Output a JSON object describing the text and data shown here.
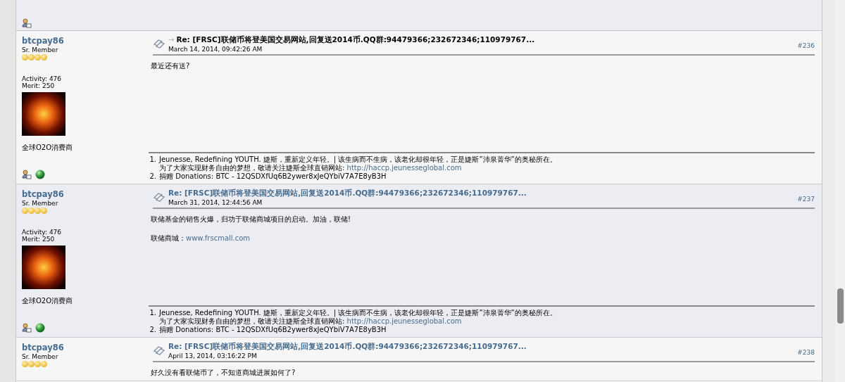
{
  "previous_post": {
    "profile_icon": true
  },
  "posts": [
    {
      "author": "btcpay86",
      "rank": "Sr. Member",
      "stars": 4,
      "activity": "Activity: 476",
      "merit": "Merit: 250",
      "personal_text": "全球O2O消费商",
      "current": true,
      "marker": "→",
      "title": "Re: [FRSC]联储币将登美国交易网站,回复送2014币.QQ群:94479366;232672346;110979767...",
      "date": "March 14, 2014, 09:42:26 AM",
      "number": "#236",
      "body": [
        {
          "text": "最近还有送?"
        }
      ],
      "signature": [
        {
          "number": "1.",
          "text": "Jeunesse, Redefining YOUTH. 婕斯，重新定义年轻。| 该生病而不生病，该老化却很年轻，正是婕斯”沛泉菁华”的奥秘所在。"
        },
        {
          "text": "为了大家实现财务自由的梦想，敬请关注婕斯全球直销网站: ",
          "link": "http://haccp.jeunesseglobal.com"
        },
        {
          "number": "2.",
          "text": "捐赠 Donations:  BTC - 12QSDXfUq6B2ywer8xJeQYbiV7A7E8yB3H"
        }
      ]
    },
    {
      "author": "btcpay86",
      "rank": "Sr. Member",
      "stars": 4,
      "activity": "Activity: 476",
      "merit": "Merit: 250",
      "personal_text": "全球O2O消费商",
      "current": false,
      "title": "Re: [FRSC]联储币将登美国交易网站,回复送2014币.QQ群:94479366;232672346;110979767...",
      "date": "March 31, 2014, 12:44:56 AM",
      "number": "#237",
      "body": [
        {
          "text": "联储基金的销售火爆，归功于联储商城项目的启动。加油，联储!"
        },
        {
          "text": "联储商城：",
          "link": "www.frscmall.com"
        }
      ],
      "signature": [
        {
          "number": "1.",
          "text": "Jeunesse, Redefining YOUTH. 婕斯，重新定义年轻。| 该生病而不生病，该老化却很年轻，正是婕斯”沛泉菁华”的奥秘所在。"
        },
        {
          "text": "为了大家实现财务自由的梦想，敬请关注婕斯全球直销网站: ",
          "link": "http://haccp.jeunesseglobal.com"
        },
        {
          "number": "2.",
          "text": "捐赠 Donations:  BTC - 12QSDXfUq6B2ywer8xJeQYbiV7A7E8yB3H"
        }
      ]
    },
    {
      "author": "btcpay86",
      "rank": "Sr. Member",
      "stars": 4,
      "current": false,
      "title": "Re: [FRSC]联储币将登美国交易网站,回复送2014币.QQ群:94479366;232672346;110979767...",
      "date": "April 13, 2014, 03:16:22 PM",
      "number": "#238",
      "body": [
        {
          "text": "好久没有看联储币了，不知道商城进展如何了?"
        }
      ]
    }
  ]
}
